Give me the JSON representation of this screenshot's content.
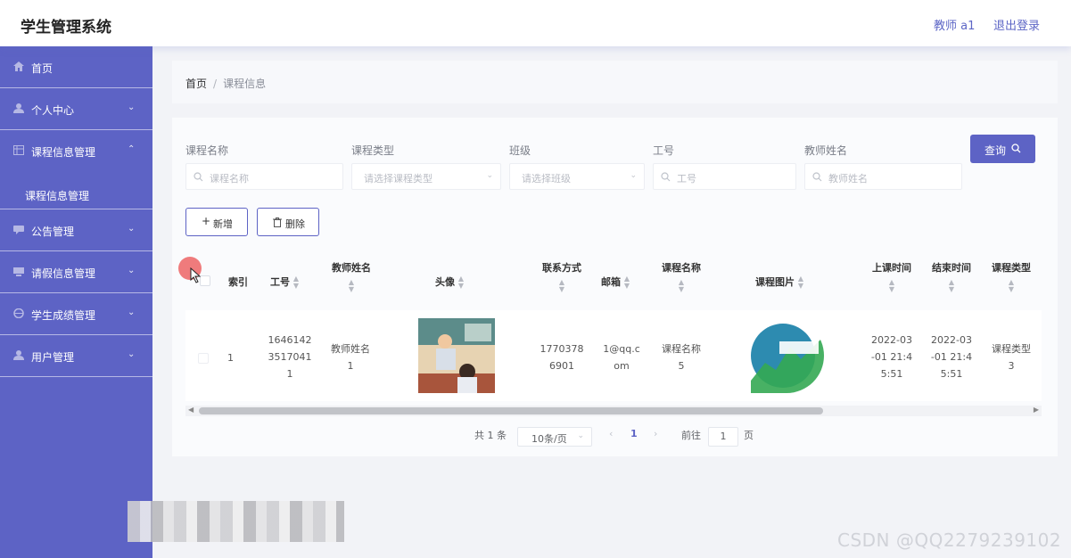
{
  "header": {
    "title": "学生管理系统",
    "user": "教师 a1",
    "logout": "退出登录"
  },
  "sidebar": {
    "items": [
      {
        "label": "首页",
        "icon": "home-icon"
      },
      {
        "label": "个人中心",
        "icon": "user-icon"
      },
      {
        "label": "课程信息管理",
        "icon": "table-icon"
      },
      {
        "label": "公告管理",
        "icon": "chat-icon"
      },
      {
        "label": "请假信息管理",
        "icon": "monitor-icon"
      },
      {
        "label": "学生成绩管理",
        "icon": "globe-icon"
      },
      {
        "label": "用户管理",
        "icon": "user-icon"
      }
    ],
    "sub_item": "课程信息管理",
    "expanded": "课程信息管理"
  },
  "breadcrumb": {
    "home": "首页",
    "sep": "/",
    "current": "课程信息"
  },
  "filters": {
    "course_name": {
      "label": "课程名称",
      "placeholder": "课程名称"
    },
    "course_type": {
      "label": "课程类型",
      "placeholder": "请选择课程类型"
    },
    "class": {
      "label": "班级",
      "placeholder": "请选择班级"
    },
    "job_no": {
      "label": "工号",
      "placeholder": "工号"
    },
    "teacher_name": {
      "label": "教师姓名",
      "placeholder": "教师姓名"
    },
    "query_button": "查询"
  },
  "actions": {
    "add": "新增",
    "delete": "删除"
  },
  "table": {
    "headers": {
      "index": "索引",
      "job_no": "工号",
      "teacher_name": "教师姓名",
      "avatar": "头像",
      "contact": "联系方式",
      "email": "邮箱",
      "course_name": "课程名称",
      "course_image": "课程图片",
      "start_time": "上课时间",
      "end_time": "结束时间",
      "course_type": "课程类型"
    },
    "rows": [
      {
        "index": "1",
        "job_no_l1": "1646142",
        "job_no_l2": "3517041",
        "job_no_l3": "1",
        "teacher_l1": "教师姓名",
        "teacher_l2": "1",
        "contact_l1": "1770378",
        "contact_l2": "6901",
        "email_l1": "1@qq.c",
        "email_l2": "om",
        "course_l1": "课程名称",
        "course_l2": "5",
        "start_l1": "2022-03",
        "start_l2": "-01 21:4",
        "start_l3": "5:51",
        "end_l1": "2022-03",
        "end_l2": "-01 21:4",
        "end_l3": "5:51",
        "type_l1": "课程类型",
        "type_l2": "3"
      }
    ]
  },
  "pagination": {
    "total": "共 1 条",
    "page_size": "10条/页",
    "current_page": "1",
    "goto_label": "前往",
    "goto_value": "1",
    "page_suffix": "页"
  },
  "watermark": "CSDN @QQ2279239102",
  "colors": {
    "sidebar": "#5d63c5",
    "accent": "#5d63c5",
    "header_link": "#5d66c6"
  }
}
